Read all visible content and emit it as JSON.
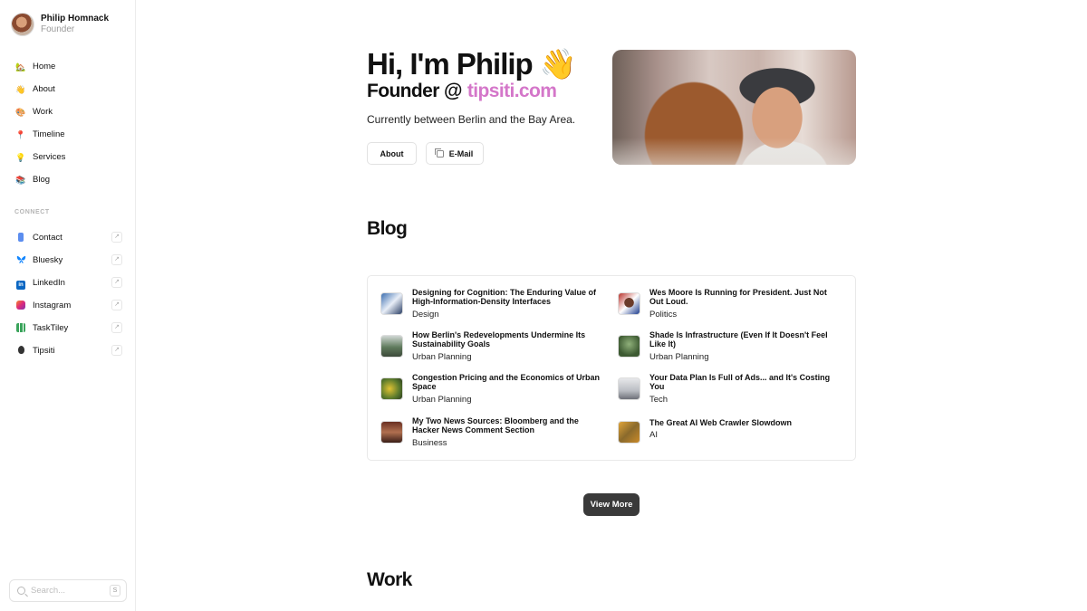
{
  "profile": {
    "name": "Philip Homnack",
    "role": "Founder"
  },
  "nav": [
    {
      "label": "Home",
      "icon": "house-icon",
      "glyph": "🏡"
    },
    {
      "label": "About",
      "icon": "waving-hand-icon",
      "glyph": "👋"
    },
    {
      "label": "Work",
      "icon": "palette-icon",
      "glyph": "🎨"
    },
    {
      "label": "Timeline",
      "icon": "pin-icon",
      "glyph": "📍"
    },
    {
      "label": "Services",
      "icon": "lightbulb-icon",
      "glyph": "💡"
    },
    {
      "label": "Blog",
      "icon": "books-icon",
      "glyph": "📚"
    }
  ],
  "connect": {
    "label": "CONNECT",
    "items": [
      {
        "label": "Contact",
        "icon": "phone-icon",
        "color": "#5b8def"
      },
      {
        "label": "Bluesky",
        "icon": "bluesky-icon",
        "color": "#1185fe"
      },
      {
        "label": "LinkedIn",
        "icon": "linkedin-icon",
        "color": "#0a66c2"
      },
      {
        "label": "Instagram",
        "icon": "instagram-icon",
        "color": "#e1306c"
      },
      {
        "label": "TaskTiley",
        "icon": "grid-icon",
        "color": "#3aa45b"
      },
      {
        "label": "Tipsiti",
        "icon": "balloon-icon",
        "color": "#333333"
      }
    ],
    "external_glyph": "↗"
  },
  "search": {
    "placeholder": "Search...",
    "shortcut": "S"
  },
  "hero": {
    "greeting": "Hi, I'm Philip 👋",
    "founder_prefix": "Founder @",
    "brand": "tipsiti.com",
    "brand_color": "#d476c9",
    "location": "Currently between Berlin and the Bay Area.",
    "about_button": "About",
    "email_button": "E-Mail"
  },
  "blog": {
    "heading": "Blog",
    "posts": [
      {
        "title": "Designing for Cognition: The Enduring Value of High-Information-Density Interfaces",
        "category": "Design"
      },
      {
        "title": "Wes Moore Is Running for President. Just Not Out Loud.",
        "category": "Politics"
      },
      {
        "title": "How Berlin's Redevelopments Undermine Its Sustainability Goals",
        "category": "Urban Planning"
      },
      {
        "title": "Shade Is Infrastructure (Even If It Doesn't Feel Like It)",
        "category": "Urban Planning"
      },
      {
        "title": "Congestion Pricing and the Economics of Urban Space",
        "category": "Urban Planning"
      },
      {
        "title": "Your Data Plan Is Full of Ads... and It's Costing You",
        "category": "Tech"
      },
      {
        "title": "My Two News Sources: Bloomberg and the Hacker News Comment Section",
        "category": "Business"
      },
      {
        "title": "The Great AI Web Crawler Slowdown",
        "category": "AI"
      }
    ],
    "view_more": "View More"
  },
  "work": {
    "heading": "Work"
  }
}
